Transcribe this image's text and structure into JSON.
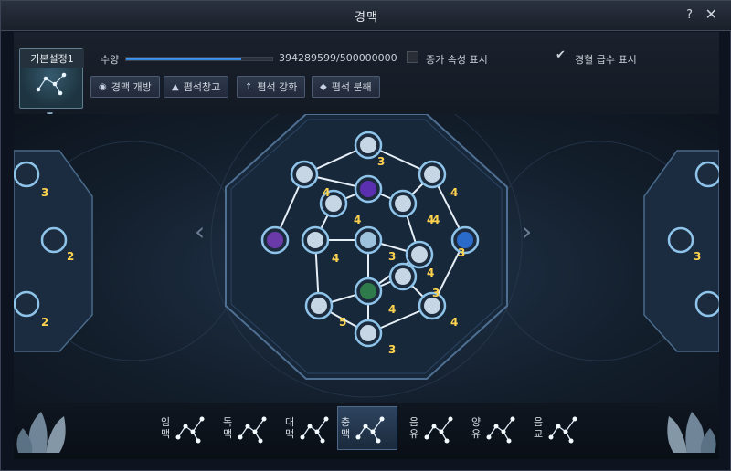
{
  "window": {
    "title": "경맥",
    "help": "?",
    "close": "✕"
  },
  "preset": {
    "label": "기본설정1",
    "icon": "constellation-icon"
  },
  "cultivation": {
    "label": "수양",
    "value": "394289599/500000000",
    "progress": 0.7886
  },
  "options": {
    "extra_attr": {
      "label": "증가 속성 표시",
      "checked": false
    },
    "grade_display": {
      "label": "경혈 급수 표시",
      "checked": true
    }
  },
  "buttons": {
    "open": {
      "label": "경맥 개방",
      "icon": "open-icon"
    },
    "reference": {
      "label": "폄석창고",
      "icon": "storage-icon"
    },
    "enhance": {
      "label": "폄석 강화",
      "icon": "enhance-icon"
    },
    "disassemble": {
      "label": "폄석 분해",
      "icon": "disassemble-icon"
    }
  },
  "nodes": [
    {
      "label": "3"
    },
    {
      "label": "4"
    },
    {
      "label": "4"
    },
    {
      "label": "4"
    },
    {
      "label": "4"
    },
    {
      "label": "3"
    },
    {
      "label": "4"
    },
    {
      "label": "3"
    },
    {
      "label": "3"
    },
    {
      "label": "4"
    },
    {
      "label": "5"
    },
    {
      "label": "4"
    },
    {
      "label": "3"
    },
    {
      "label": "4"
    },
    {
      "label": "4"
    }
  ],
  "side_left_nodes": [
    {
      "label": "3"
    },
    {
      "label": "2"
    },
    {
      "label": "2"
    }
  ],
  "side_right_nodes": [
    {
      "label": "3"
    }
  ],
  "categories": [
    {
      "label": "임\n맥",
      "active": false
    },
    {
      "label": "독\n맥",
      "active": false
    },
    {
      "label": "대\n맥",
      "active": false
    },
    {
      "label": "충\n맥",
      "active": true
    },
    {
      "label": "음\n유",
      "active": false
    },
    {
      "label": "양\n유",
      "active": false
    },
    {
      "label": "음\n교",
      "active": false
    }
  ],
  "colors": {
    "accent": "#3d9cf2",
    "number": "#ffd34d",
    "node_ring": "#8fc4ea"
  }
}
